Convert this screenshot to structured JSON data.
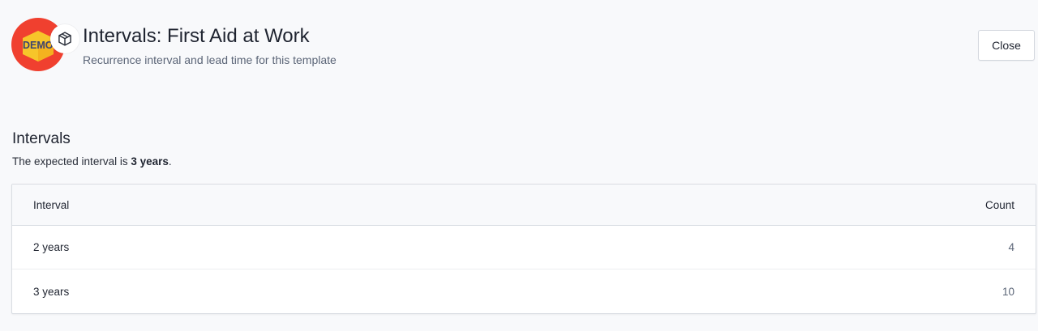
{
  "header": {
    "logo_text": "DEMO",
    "title": "Intervals: First Aid at Work",
    "subtitle": "Recurrence interval and lead time for this template",
    "close_label": "Close",
    "logo_icon": "demo-logo",
    "template_icon": "cube-icon"
  },
  "section": {
    "title": "Intervals",
    "desc_prefix": "The expected interval is ",
    "desc_value": "3 years",
    "desc_suffix": "."
  },
  "table": {
    "columns": [
      "Interval",
      "Count"
    ],
    "rows": [
      {
        "interval": "2 years",
        "count": "4"
      },
      {
        "interval": "3 years",
        "count": "10"
      }
    ]
  },
  "colors": {
    "background": "#f8f9fb",
    "logo_outer": "#f0402f",
    "logo_inner": "#f7c52a",
    "logo_text": "#3d4470"
  }
}
